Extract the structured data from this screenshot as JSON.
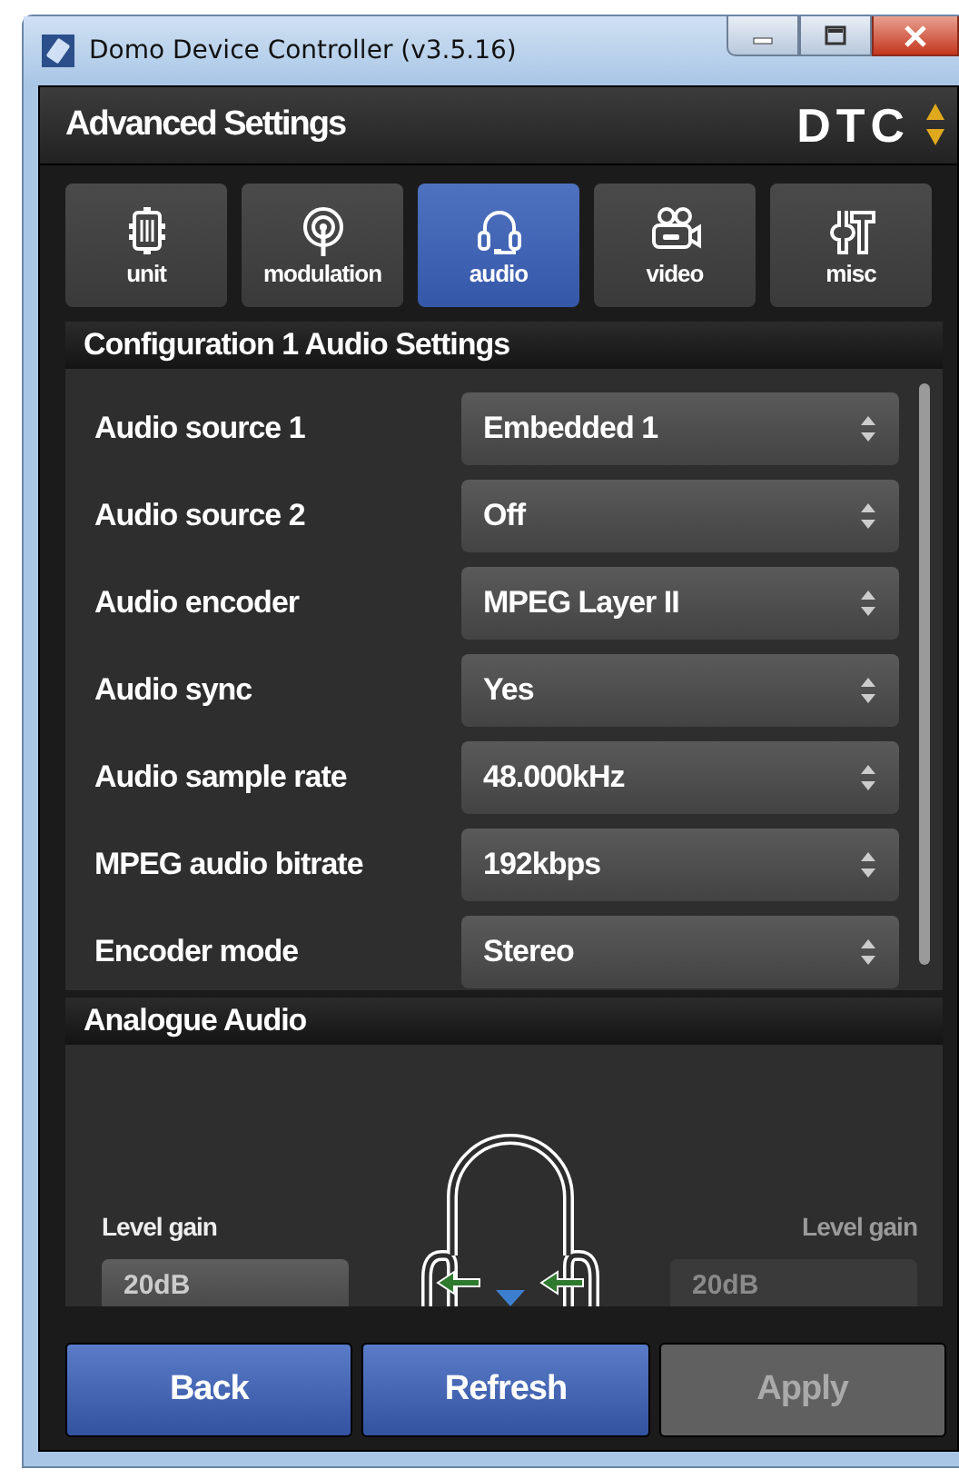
{
  "window": {
    "title": "Domo Device Controller (v3.5.16)"
  },
  "header": {
    "title": "Advanced Settings",
    "logo": "DTC"
  },
  "tabs": [
    {
      "label": "unit",
      "kind": "chip",
      "selected": false
    },
    {
      "label": "modulation",
      "kind": "antenna",
      "selected": false
    },
    {
      "label": "audio",
      "kind": "headset",
      "selected": true
    },
    {
      "label": "video",
      "kind": "camera",
      "selected": false
    },
    {
      "label": "misc",
      "kind": "tools",
      "selected": false
    }
  ],
  "settings": {
    "title": "Configuration 1 Audio Settings",
    "rows": [
      {
        "label": "Audio source 1",
        "value": "Embedded 1"
      },
      {
        "label": "Audio source 2",
        "value": "Off"
      },
      {
        "label": "Audio encoder",
        "value": "MPEG Layer II"
      },
      {
        "label": "Audio sync",
        "value": "Yes"
      },
      {
        "label": "Audio sample rate",
        "value": "48.000kHz"
      },
      {
        "label": "MPEG audio bitrate",
        "value": "192kbps"
      },
      {
        "label": "Encoder mode",
        "value": "Stereo"
      }
    ]
  },
  "analogue": {
    "title": "Analogue Audio",
    "gains": [
      {
        "label": "Level gain",
        "value": "20dB",
        "disabled": false
      },
      {
        "label": "Level gain",
        "value": "20dB",
        "disabled": true
      }
    ]
  },
  "buttons": [
    {
      "label": "Back",
      "disabled": false
    },
    {
      "label": "Refresh",
      "disabled": false
    },
    {
      "label": "Apply",
      "disabled": true
    }
  ]
}
